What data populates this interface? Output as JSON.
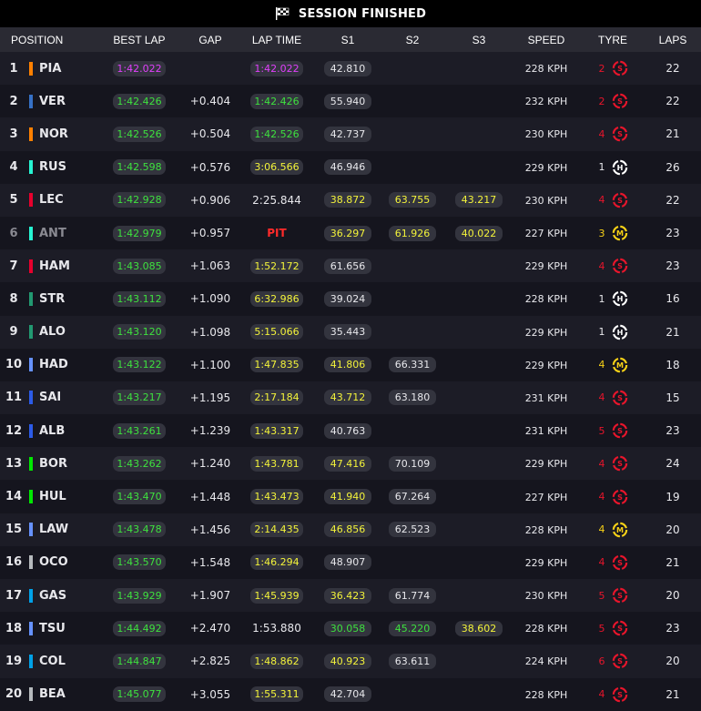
{
  "header": {
    "title": "SESSION FINISHED",
    "icon": "chequered-flag-icon"
  },
  "columns": [
    "POSITION",
    "BEST LAP",
    "GAP",
    "LAP TIME",
    "S1",
    "S2",
    "S3",
    "SPEED",
    "TYRE",
    "LAPS"
  ],
  "colors": {
    "purple": "#e040fb",
    "green": "#3ee13e",
    "yellow": "#f3f33a",
    "red": "#ff2a2a",
    "soft": "#e8152b",
    "medium": "#f7d117",
    "hard": "#ffffff"
  },
  "rows": [
    {
      "pos": "1",
      "code": "PIA",
      "team": "#ff8000",
      "best": "1:42.022",
      "bestColor": "purple",
      "gap": "",
      "lap": "1:42.022",
      "lapColor": "purple",
      "s1": "42.810",
      "s1Color": "white",
      "s2": "",
      "s2Color": "white",
      "s3": "",
      "s3Color": "white",
      "speed": "228 KPH",
      "age": "2",
      "compound": "S",
      "laps": "22",
      "dim": false
    },
    {
      "pos": "2",
      "code": "VER",
      "team": "#3671c6",
      "best": "1:42.426",
      "bestColor": "green",
      "gap": "+0.404",
      "lap": "1:42.426",
      "lapColor": "green",
      "s1": "55.940",
      "s1Color": "white",
      "s2": "",
      "s2Color": "white",
      "s3": "",
      "s3Color": "white",
      "speed": "232 KPH",
      "age": "2",
      "compound": "S",
      "laps": "22",
      "dim": false
    },
    {
      "pos": "3",
      "code": "NOR",
      "team": "#ff8000",
      "best": "1:42.526",
      "bestColor": "green",
      "gap": "+0.504",
      "lap": "1:42.526",
      "lapColor": "green",
      "s1": "42.737",
      "s1Color": "white",
      "s2": "",
      "s2Color": "white",
      "s3": "",
      "s3Color": "white",
      "speed": "230 KPH",
      "age": "4",
      "compound": "S",
      "laps": "21",
      "dim": false
    },
    {
      "pos": "4",
      "code": "RUS",
      "team": "#27f4d2",
      "best": "1:42.598",
      "bestColor": "green",
      "gap": "+0.576",
      "lap": "3:06.566",
      "lapColor": "yellow",
      "s1": "46.946",
      "s1Color": "white",
      "s2": "",
      "s2Color": "white",
      "s3": "",
      "s3Color": "white",
      "speed": "229 KPH",
      "age": "1",
      "compound": "H",
      "laps": "26",
      "dim": false
    },
    {
      "pos": "5",
      "code": "LEC",
      "team": "#e8002d",
      "best": "1:42.928",
      "bestColor": "green",
      "gap": "+0.906",
      "lap": "2:25.844",
      "lapColor": "white",
      "s1": "38.872",
      "s1Color": "yellow",
      "s2": "63.755",
      "s2Color": "yellow",
      "s3": "43.217",
      "s3Color": "yellow",
      "speed": "230 KPH",
      "age": "4",
      "compound": "S",
      "laps": "22",
      "dim": false
    },
    {
      "pos": "6",
      "code": "ANT",
      "team": "#27f4d2",
      "best": "1:42.979",
      "bestColor": "green",
      "gap": "+0.957",
      "lap": "PIT",
      "lapColor": "pit",
      "s1": "36.297",
      "s1Color": "yellow",
      "s2": "61.926",
      "s2Color": "yellow",
      "s3": "40.022",
      "s3Color": "yellow",
      "speed": "227 KPH",
      "age": "3",
      "compound": "M",
      "laps": "23",
      "dim": true
    },
    {
      "pos": "7",
      "code": "HAM",
      "team": "#e8002d",
      "best": "1:43.085",
      "bestColor": "green",
      "gap": "+1.063",
      "lap": "1:52.172",
      "lapColor": "yellow",
      "s1": "61.656",
      "s1Color": "white",
      "s2": "",
      "s2Color": "white",
      "s3": "",
      "s3Color": "white",
      "speed": "229 KPH",
      "age": "4",
      "compound": "S",
      "laps": "23",
      "dim": false
    },
    {
      "pos": "8",
      "code": "STR",
      "team": "#229971",
      "best": "1:43.112",
      "bestColor": "green",
      "gap": "+1.090",
      "lap": "6:32.986",
      "lapColor": "yellow",
      "s1": "39.024",
      "s1Color": "white",
      "s2": "",
      "s2Color": "white",
      "s3": "",
      "s3Color": "white",
      "speed": "228 KPH",
      "age": "1",
      "compound": "H",
      "laps": "16",
      "dim": false
    },
    {
      "pos": "9",
      "code": "ALO",
      "team": "#229971",
      "best": "1:43.120",
      "bestColor": "green",
      "gap": "+1.098",
      "lap": "5:15.066",
      "lapColor": "yellow",
      "s1": "35.443",
      "s1Color": "white",
      "s2": "",
      "s2Color": "white",
      "s3": "",
      "s3Color": "white",
      "speed": "229 KPH",
      "age": "1",
      "compound": "H",
      "laps": "21",
      "dim": false
    },
    {
      "pos": "10",
      "code": "HAD",
      "team": "#6692ff",
      "best": "1:43.122",
      "bestColor": "green",
      "gap": "+1.100",
      "lap": "1:47.835",
      "lapColor": "yellow",
      "s1": "41.806",
      "s1Color": "yellow",
      "s2": "66.331",
      "s2Color": "white",
      "s3": "",
      "s3Color": "white",
      "speed": "229 KPH",
      "age": "4",
      "compound": "M",
      "laps": "18",
      "dim": false
    },
    {
      "pos": "11",
      "code": "SAI",
      "team": "#2c5be8",
      "best": "1:43.217",
      "bestColor": "green",
      "gap": "+1.195",
      "lap": "2:17.184",
      "lapColor": "yellow",
      "s1": "43.712",
      "s1Color": "yellow",
      "s2": "63.180",
      "s2Color": "white",
      "s3": "",
      "s3Color": "white",
      "speed": "231 KPH",
      "age": "4",
      "compound": "S",
      "laps": "15",
      "dim": false
    },
    {
      "pos": "12",
      "code": "ALB",
      "team": "#2c5be8",
      "best": "1:43.261",
      "bestColor": "green",
      "gap": "+1.239",
      "lap": "1:43.317",
      "lapColor": "yellow",
      "s1": "40.763",
      "s1Color": "white",
      "s2": "",
      "s2Color": "white",
      "s3": "",
      "s3Color": "white",
      "speed": "231 KPH",
      "age": "5",
      "compound": "S",
      "laps": "23",
      "dim": false
    },
    {
      "pos": "13",
      "code": "BOR",
      "team": "#00e701",
      "best": "1:43.262",
      "bestColor": "green",
      "gap": "+1.240",
      "lap": "1:43.781",
      "lapColor": "yellow",
      "s1": "47.416",
      "s1Color": "yellow",
      "s2": "70.109",
      "s2Color": "white",
      "s3": "",
      "s3Color": "white",
      "speed": "229 KPH",
      "age": "4",
      "compound": "S",
      "laps": "24",
      "dim": false
    },
    {
      "pos": "14",
      "code": "HUL",
      "team": "#00e701",
      "best": "1:43.470",
      "bestColor": "green",
      "gap": "+1.448",
      "lap": "1:43.473",
      "lapColor": "yellow",
      "s1": "41.940",
      "s1Color": "yellow",
      "s2": "67.264",
      "s2Color": "white",
      "s3": "",
      "s3Color": "white",
      "speed": "227 KPH",
      "age": "4",
      "compound": "S",
      "laps": "19",
      "dim": false
    },
    {
      "pos": "15",
      "code": "LAW",
      "team": "#6692ff",
      "best": "1:43.478",
      "bestColor": "green",
      "gap": "+1.456",
      "lap": "2:14.435",
      "lapColor": "yellow",
      "s1": "46.856",
      "s1Color": "yellow",
      "s2": "62.523",
      "s2Color": "white",
      "s3": "",
      "s3Color": "white",
      "speed": "228 KPH",
      "age": "4",
      "compound": "M",
      "laps": "20",
      "dim": false
    },
    {
      "pos": "16",
      "code": "OCO",
      "team": "#b6babd",
      "best": "1:43.570",
      "bestColor": "green",
      "gap": "+1.548",
      "lap": "1:46.294",
      "lapColor": "yellow",
      "s1": "48.907",
      "s1Color": "white",
      "s2": "",
      "s2Color": "white",
      "s3": "",
      "s3Color": "white",
      "speed": "229 KPH",
      "age": "4",
      "compound": "S",
      "laps": "21",
      "dim": false
    },
    {
      "pos": "17",
      "code": "GAS",
      "team": "#00a1e8",
      "best": "1:43.929",
      "bestColor": "green",
      "gap": "+1.907",
      "lap": "1:45.939",
      "lapColor": "yellow",
      "s1": "36.423",
      "s1Color": "yellow",
      "s2": "61.774",
      "s2Color": "white",
      "s3": "",
      "s3Color": "white",
      "speed": "230 KPH",
      "age": "5",
      "compound": "S",
      "laps": "20",
      "dim": false
    },
    {
      "pos": "18",
      "code": "TSU",
      "team": "#6692ff",
      "best": "1:44.492",
      "bestColor": "green",
      "gap": "+2.470",
      "lap": "1:53.880",
      "lapColor": "white",
      "s1": "30.058",
      "s1Color": "green",
      "s2": "45.220",
      "s2Color": "green",
      "s3": "38.602",
      "s3Color": "yellow",
      "speed": "228 KPH",
      "age": "5",
      "compound": "S",
      "laps": "23",
      "dim": false
    },
    {
      "pos": "19",
      "code": "COL",
      "team": "#00a1e8",
      "best": "1:44.847",
      "bestColor": "green",
      "gap": "+2.825",
      "lap": "1:48.862",
      "lapColor": "yellow",
      "s1": "40.923",
      "s1Color": "yellow",
      "s2": "63.611",
      "s2Color": "white",
      "s3": "",
      "s3Color": "white",
      "speed": "224 KPH",
      "age": "6",
      "compound": "S",
      "laps": "20",
      "dim": false
    },
    {
      "pos": "20",
      "code": "BEA",
      "team": "#b6babd",
      "best": "1:45.077",
      "bestColor": "green",
      "gap": "+3.055",
      "lap": "1:55.311",
      "lapColor": "yellow",
      "s1": "42.704",
      "s1Color": "white",
      "s2": "",
      "s2Color": "white",
      "s3": "",
      "s3Color": "white",
      "speed": "228 KPH",
      "age": "4",
      "compound": "S",
      "laps": "21",
      "dim": false
    }
  ]
}
